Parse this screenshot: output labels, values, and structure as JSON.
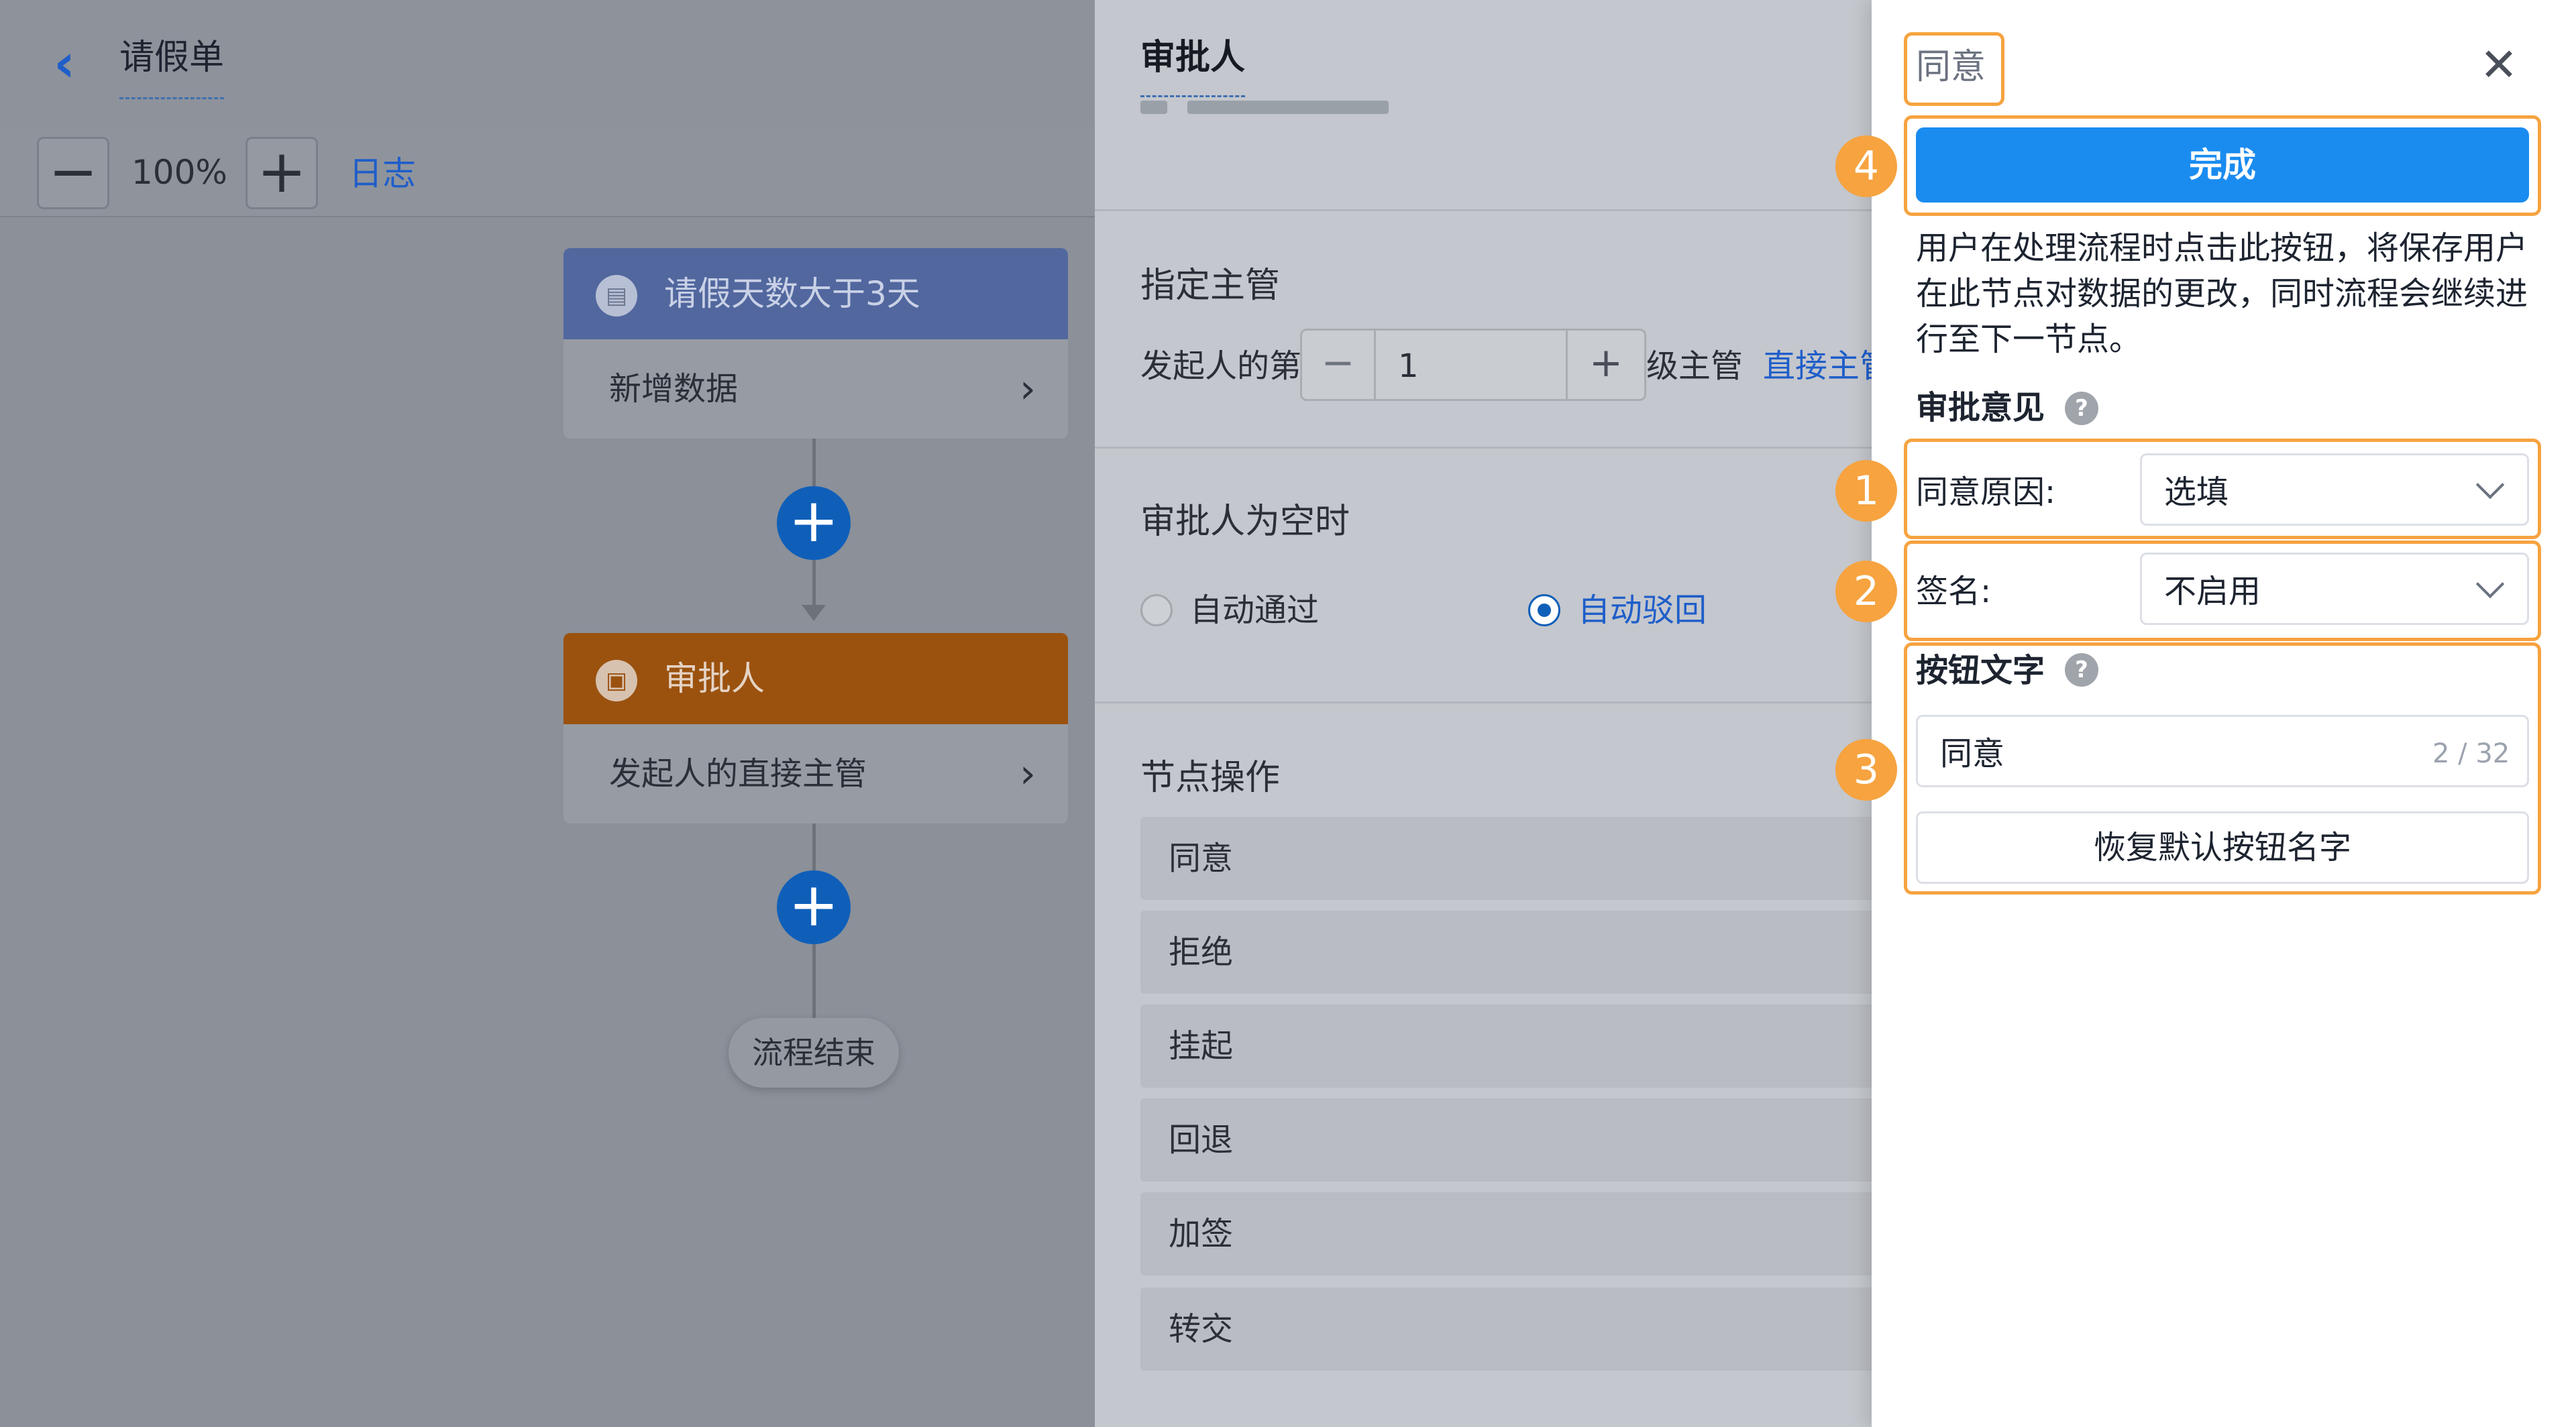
{
  "header": {
    "back_icon": "chevron-left-icon",
    "title": "请假单"
  },
  "zoom": {
    "minus": "−",
    "level": "100%",
    "plus": "+",
    "log_link": "日志"
  },
  "flow": {
    "node1": {
      "title": "请假天数大于3天",
      "icon": "document-icon",
      "body": "新增数据"
    },
    "node2": {
      "title": "审批人",
      "icon": "approver-icon",
      "body": "发起人的直接主管"
    },
    "add_label": "+",
    "end_label": "流程结束",
    "colors": {
      "node1_header": "#51679e",
      "node2_header": "#9b520f",
      "add_button": "#0f5fb9"
    }
  },
  "middle": {
    "tab_title": "审批人",
    "supervisor": {
      "title": "指定主管",
      "prefix": "发起人的第",
      "stepper_minus": "−",
      "stepper_value": "1",
      "stepper_plus": "+",
      "suffix": "级主管",
      "link": "直接主管"
    },
    "empty_approver": {
      "title": "审批人为空时",
      "options": [
        "自动通过",
        "自动驳回"
      ],
      "selected": "自动驳回"
    },
    "operations": {
      "title": "节点操作",
      "items": [
        "同意",
        "拒绝",
        "挂起",
        "回退",
        "加签",
        "转交"
      ]
    }
  },
  "drawer": {
    "title": "同意",
    "close_icon": "close-icon",
    "done_button": "完成",
    "done_description": "用户在处理流程时点击此按钮，将保存用户在此节点对数据的更改，同时流程会继续进行至下一节点。",
    "opinion_title": "审批意见",
    "help_icon": "?",
    "reason_label": "同意原因:",
    "reason_value": "选填",
    "sign_label": "签名:",
    "sign_value": "不启用",
    "button_text_title": "按钮文字",
    "button_text_value": "同意",
    "button_text_count": "2 / 32",
    "restore_button": "恢复默认按钮名字",
    "colors": {
      "primary": "#1a8cf0",
      "highlight": "#f6a340"
    }
  },
  "badges": [
    "4",
    "1",
    "2",
    "3"
  ]
}
